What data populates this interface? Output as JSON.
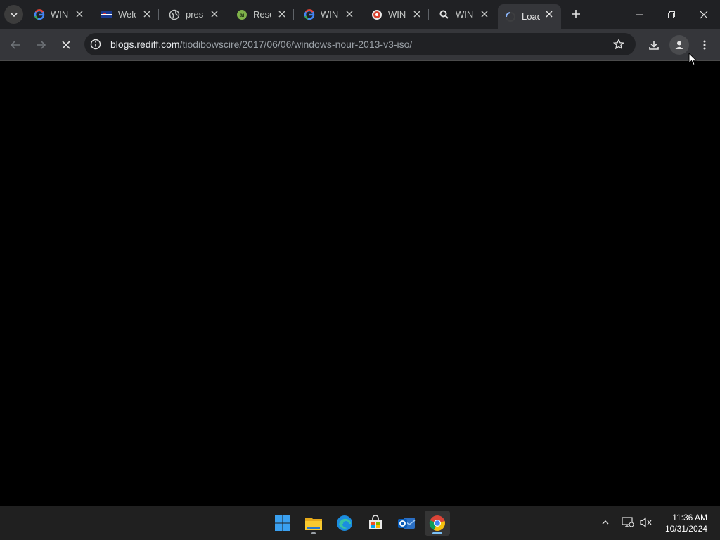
{
  "browser": {
    "tabs": [
      {
        "title": "WIN",
        "icon": "google-icon",
        "active": false
      },
      {
        "title": "Welc",
        "icon": "flag-icon",
        "active": false
      },
      {
        "title": "pres",
        "icon": "globe-icon",
        "active": false
      },
      {
        "title": "Reso",
        "icon": "green-ai-icon",
        "active": false
      },
      {
        "title": "WIN",
        "icon": "google-icon",
        "active": false
      },
      {
        "title": "WIN",
        "icon": "red-shield-icon",
        "active": false
      },
      {
        "title": "WIN",
        "icon": "search-icon",
        "active": false
      },
      {
        "title": "Load",
        "icon": "loading-spinner-icon",
        "active": true
      }
    ],
    "address_bar": {
      "host": "blogs.rediff.com",
      "path": "/tiodibowscire/2017/06/06/windows-nour-2013-v3-iso/"
    },
    "colors": {
      "titlebar": "#202124",
      "toolbar": "#35363a",
      "accent": "#8ab4f8"
    }
  },
  "taskbar": {
    "apps": [
      "windows-start-icon",
      "file-explorer-icon",
      "edge-icon",
      "store-icon",
      "outlook-icon",
      "chrome-icon"
    ],
    "clock": {
      "time": "11:36 AM",
      "date": "10/31/2024"
    }
  }
}
